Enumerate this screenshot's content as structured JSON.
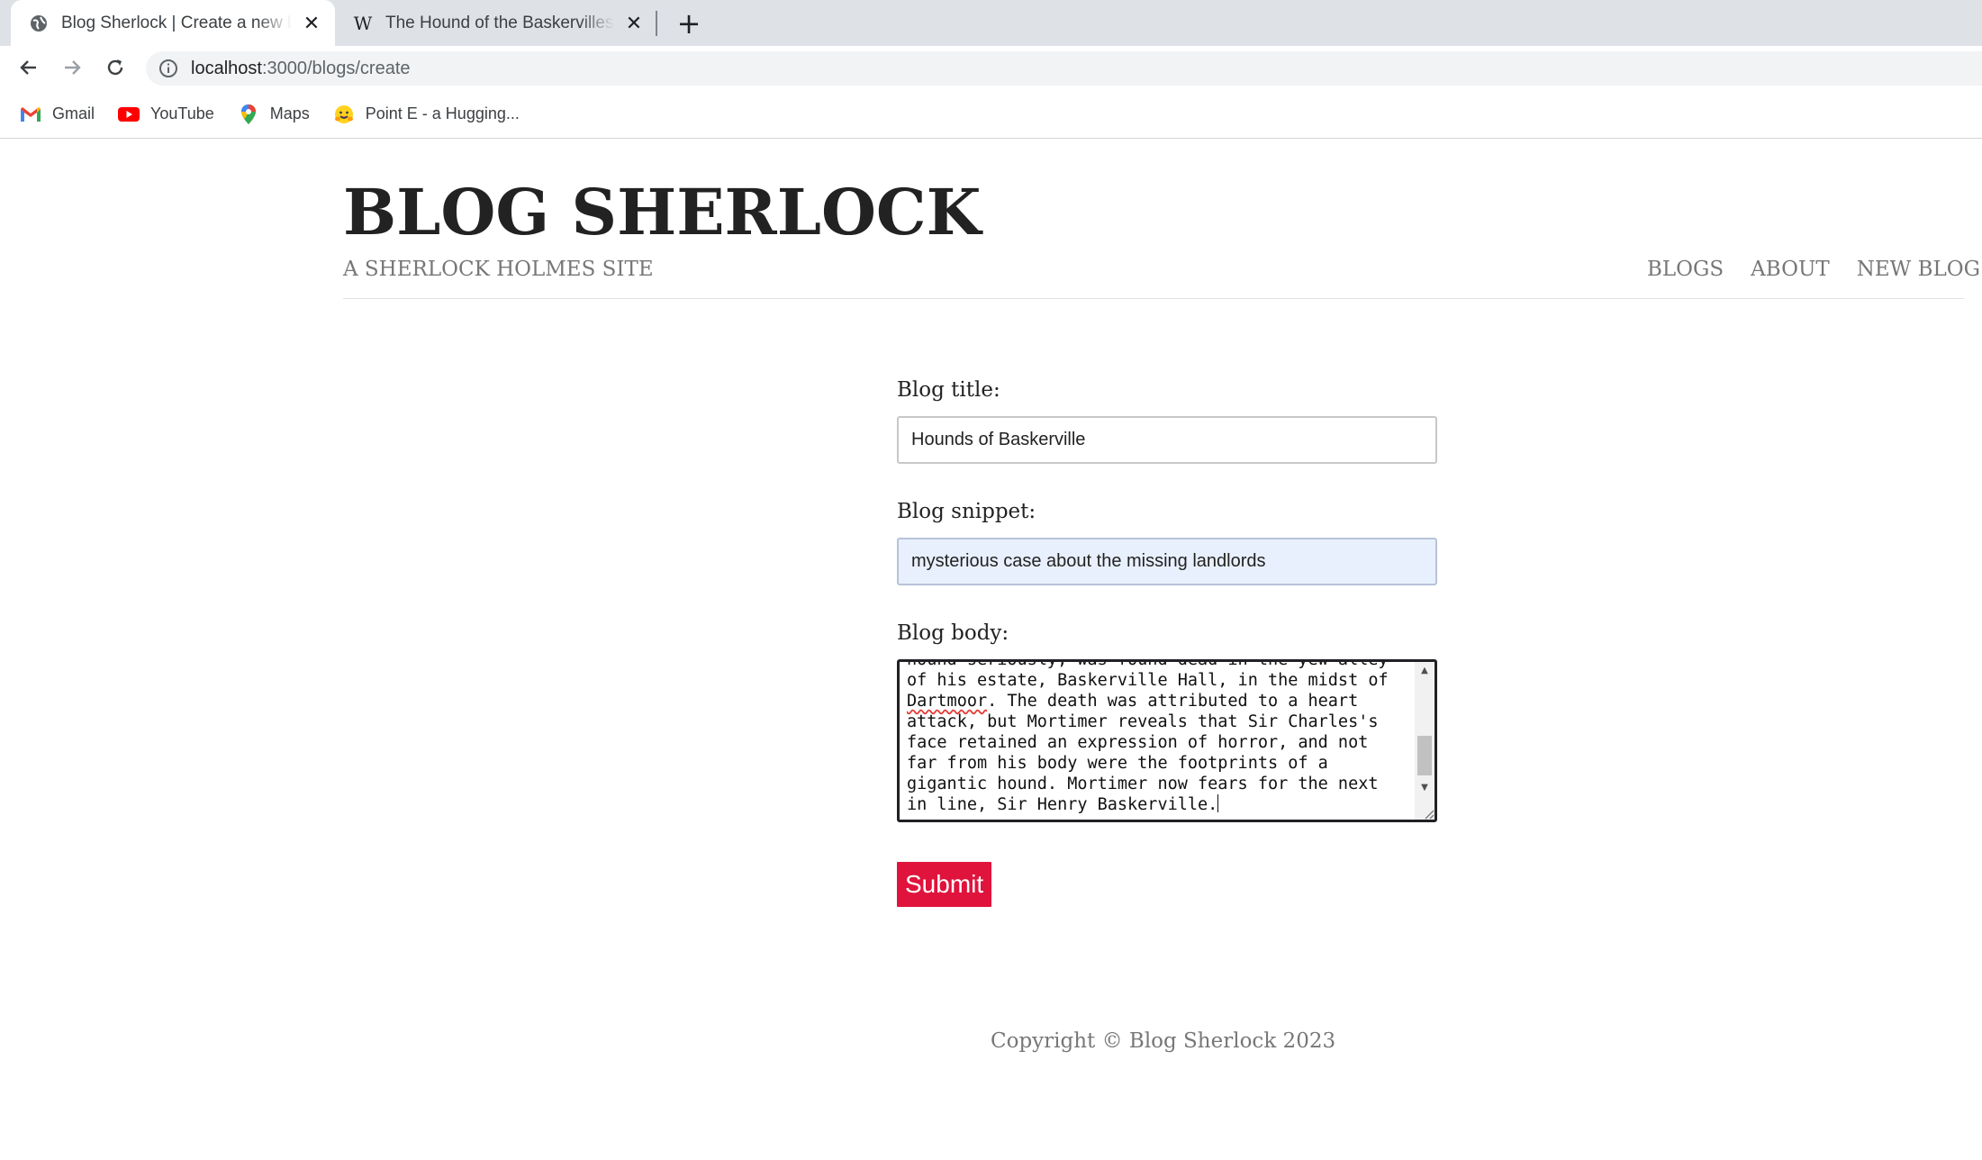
{
  "browser": {
    "tabs": [
      {
        "title": "Blog Sherlock | Create a new blog",
        "icon": "globe-icon",
        "active": true
      },
      {
        "title": "The Hound of the Baskervilles - Wikipedia",
        "icon": "wikipedia-icon",
        "active": false
      }
    ],
    "new_tab_glyph": "+",
    "close_glyph": "✕",
    "address": {
      "host": "localhost",
      "path": ":3000/blogs/create"
    },
    "bookmarks": [
      {
        "label": "Gmail",
        "icon": "gmail-icon"
      },
      {
        "label": "YouTube",
        "icon": "youtube-icon"
      },
      {
        "label": "Maps",
        "icon": "maps-icon"
      },
      {
        "label": "Point E - a Hugging...",
        "icon": "hugging-face-icon"
      }
    ]
  },
  "site": {
    "title": "BLOG SHERLOCK",
    "subtitle": "A SHERLOCK HOLMES SITE",
    "nav": [
      "BLOGS",
      "ABOUT",
      "NEW BLOG"
    ]
  },
  "form": {
    "title_label": "Blog title:",
    "title_value": "Hounds of Baskerville",
    "snippet_label": "Blog snippet:",
    "snippet_value": "mysterious case about the missing landlords",
    "body_label": "Blog body:",
    "body_lines": [
      "hound seriously, was found dead in the yew alley",
      "of his estate, Baskerville Hall, in the midst of",
      ". The death was attributed to a heart",
      "attack, but Mortimer reveals that Sir Charles's",
      "face retained an expression of horror, and not",
      "far from his body were the footprints of a",
      "gigantic hound. Mortimer now fears for the next",
      "in line, Sir Henry Baskerville."
    ],
    "body_misspelled_word": "Dartmoor",
    "submit_label": "Submit"
  },
  "footer": {
    "copyright": "Copyright © Blog Sherlock 2023"
  },
  "colors": {
    "accent": "#e0133c",
    "heading": "#222222",
    "muted": "#777777",
    "autofill_bg": "#e8f0fe"
  }
}
